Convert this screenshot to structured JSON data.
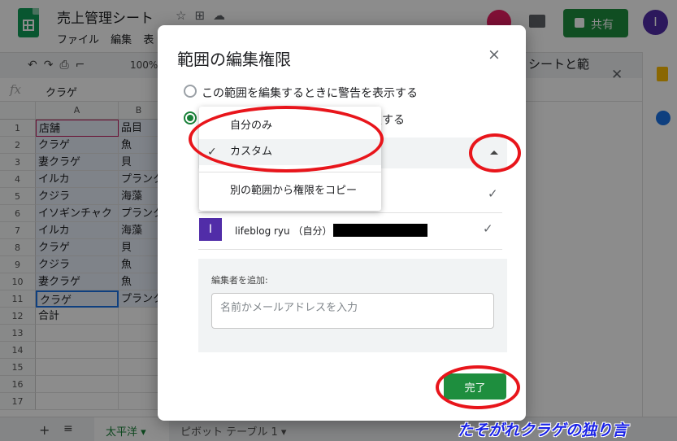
{
  "app": {
    "doc_title": "売上管理シート",
    "menus": [
      "ファイル",
      "編集",
      "表"
    ],
    "share_label": "共有",
    "user_initial": "I",
    "zoom": "100%",
    "formula_value": "クラゲ",
    "fx_label": "fx"
  },
  "sheet": {
    "col_headers": [
      "A",
      "B"
    ],
    "rows": [
      {
        "n": "1",
        "a": "店舗",
        "b": "品目"
      },
      {
        "n": "2",
        "a": "クラゲ",
        "b": "魚"
      },
      {
        "n": "3",
        "a": "妻クラゲ",
        "b": "貝"
      },
      {
        "n": "4",
        "a": "イルカ",
        "b": "プランク"
      },
      {
        "n": "5",
        "a": "クジラ",
        "b": "海藻"
      },
      {
        "n": "6",
        "a": "イソギンチャク",
        "b": "プランク"
      },
      {
        "n": "7",
        "a": "イルカ",
        "b": "海藻"
      },
      {
        "n": "8",
        "a": "クラゲ",
        "b": "貝"
      },
      {
        "n": "9",
        "a": "クジラ",
        "b": "魚"
      },
      {
        "n": "10",
        "a": "妻クラゲ",
        "b": "魚"
      },
      {
        "n": "11",
        "a": "クラゲ",
        "b": "プランク"
      },
      {
        "n": "12",
        "a": "合計",
        "b": ""
      },
      {
        "n": "13",
        "a": "",
        "b": ""
      },
      {
        "n": "14",
        "a": "",
        "b": ""
      },
      {
        "n": "15",
        "a": "",
        "b": ""
      },
      {
        "n": "16",
        "a": "",
        "b": ""
      },
      {
        "n": "17",
        "a": "",
        "b": ""
      }
    ],
    "tabs": [
      "太平洋",
      "ピボット テーブル 1"
    ]
  },
  "side_panel": {
    "title_fragment": "シートと範"
  },
  "dialog": {
    "title": "範囲の編集権限",
    "close": "×",
    "option_warn": "この範囲を編集するときに警告を表示する",
    "option_restrict_tail": "限する",
    "user_initial": "I",
    "user_label": "lifeblog ryu （自分）",
    "check": "✓",
    "add_editors_label": "編集者を追加:",
    "add_editors_placeholder": "名前かメールアドレスを入力",
    "done_label": "完了"
  },
  "menu": {
    "items": [
      "自分のみ",
      "カスタム",
      "別の範囲から権限をコピー"
    ],
    "selected_index": 1
  },
  "watermark": "たそがれクラゲの独り言",
  "colors": {
    "accent_green": "#1e8e3e",
    "annotation_red": "#e8151b",
    "watermark_blue": "#1a22e6",
    "user_purple": "#512da8"
  }
}
